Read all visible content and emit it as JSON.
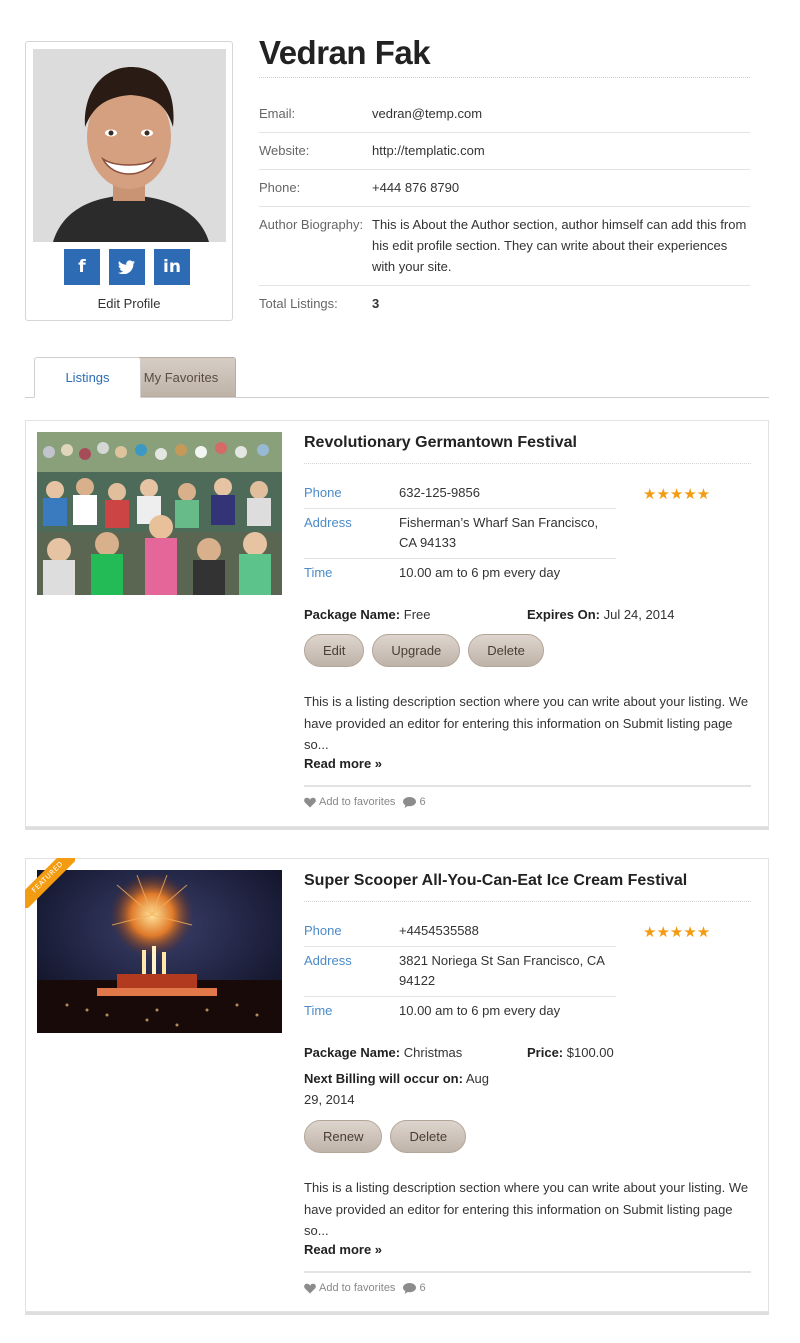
{
  "profile": {
    "name": "Vedran Fak",
    "social": {
      "facebook": "f",
      "twitter": "t",
      "linkedin": "in"
    },
    "edit_label": "Edit Profile",
    "fields": [
      {
        "label": "Email:",
        "value": "vedran@temp.com"
      },
      {
        "label": "Website:",
        "value": "http://templatic.com"
      },
      {
        "label": "Phone:",
        "value": "+444 876 8790"
      },
      {
        "label": "Author Biography:",
        "value": "This is About the Author section, author himself can add this from his edit profile section. They can write about their experiences with your site."
      },
      {
        "label": "Total Listings:",
        "value": "3"
      }
    ]
  },
  "tabs": [
    {
      "label": "Listings",
      "active": true
    },
    {
      "label": "My Favorites",
      "active": false
    }
  ],
  "listings": [
    {
      "title": "Revolutionary Germantown Festival",
      "featured": false,
      "rating": 5,
      "stars": "★★★★★",
      "details": [
        {
          "label": "Phone",
          "value": "632-125-9856"
        },
        {
          "label": "Address",
          "value": "Fisherman’s Wharf San Francisco, CA 94133"
        },
        {
          "label": "Time",
          "value": "10.00 am to 6 pm every day"
        }
      ],
      "package_label": "Package Name:",
      "package_value": "Free",
      "extra_label": "Expires On:",
      "extra_value": "Jul 24, 2014",
      "buttons": [
        "Edit",
        "Upgrade",
        "Delete"
      ],
      "description": "This is a listing description section where you can write about your listing. We have provided an editor for entering this information on Submit listing page so...",
      "read_more": "Read more »",
      "favorites_label": "Add to favorites",
      "comments": "6"
    },
    {
      "title": "Super Scooper All-You-Can-Eat Ice Cream Festival",
      "featured": true,
      "featured_label": "FEATURED",
      "rating": 5,
      "stars": "★★★★★",
      "details": [
        {
          "label": "Phone",
          "value": "+4454535588"
        },
        {
          "label": "Address",
          "value": "3821 Noriega St San Francisco, CA 94122"
        },
        {
          "label": "Time",
          "value": "10.00 am to 6 pm every day"
        }
      ],
      "package_label": "Package Name:",
      "package_value": "Christmas",
      "extra_label": "Price:",
      "extra_value": "$100.00",
      "billing_label": "Next Billing will occur on:",
      "billing_value": "Aug 29, 2014",
      "buttons": [
        "Renew",
        "Delete"
      ],
      "description": "This is a listing description section where you can write about your listing. We have provided an editor for entering this information on Submit listing page so...",
      "read_more": "Read more »",
      "favorites_label": "Add to favorites",
      "comments": "6"
    }
  ],
  "colors": {
    "social_blue": "#2d6bb5",
    "link_blue": "#4a8bc8",
    "star_orange": "#f39c12",
    "pill_tan": "#c9beb4"
  }
}
